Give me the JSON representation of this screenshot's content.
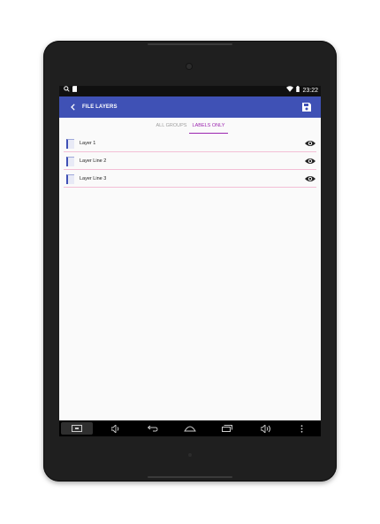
{
  "statusbar": {
    "time": "23:22",
    "icons": [
      "search-icon",
      "sd-card-icon",
      "wifi-icon",
      "battery-icon"
    ]
  },
  "appbar": {
    "title": "FILE LAYERS",
    "back_icon": "arrow-back-icon",
    "save_icon": "save-icon",
    "color": "#3f51b5"
  },
  "tabs": [
    {
      "label": "ALL GROUPS",
      "active": false
    },
    {
      "label": "LABELS ONLY",
      "active": true
    }
  ],
  "accent": "#9c27b0",
  "layers": [
    {
      "label": "Layer 1",
      "visible_icon": "eye-icon"
    },
    {
      "label": "Layer Line 2",
      "visible_icon": "eye-icon"
    },
    {
      "label": "Layer Line 3",
      "visible_icon": "eye-icon"
    }
  ],
  "navbar": {
    "buttons": [
      "screenshot-icon",
      "volume-down-icon",
      "back-icon",
      "home-icon",
      "recents-icon",
      "volume-up-icon",
      "more-icon"
    ]
  }
}
